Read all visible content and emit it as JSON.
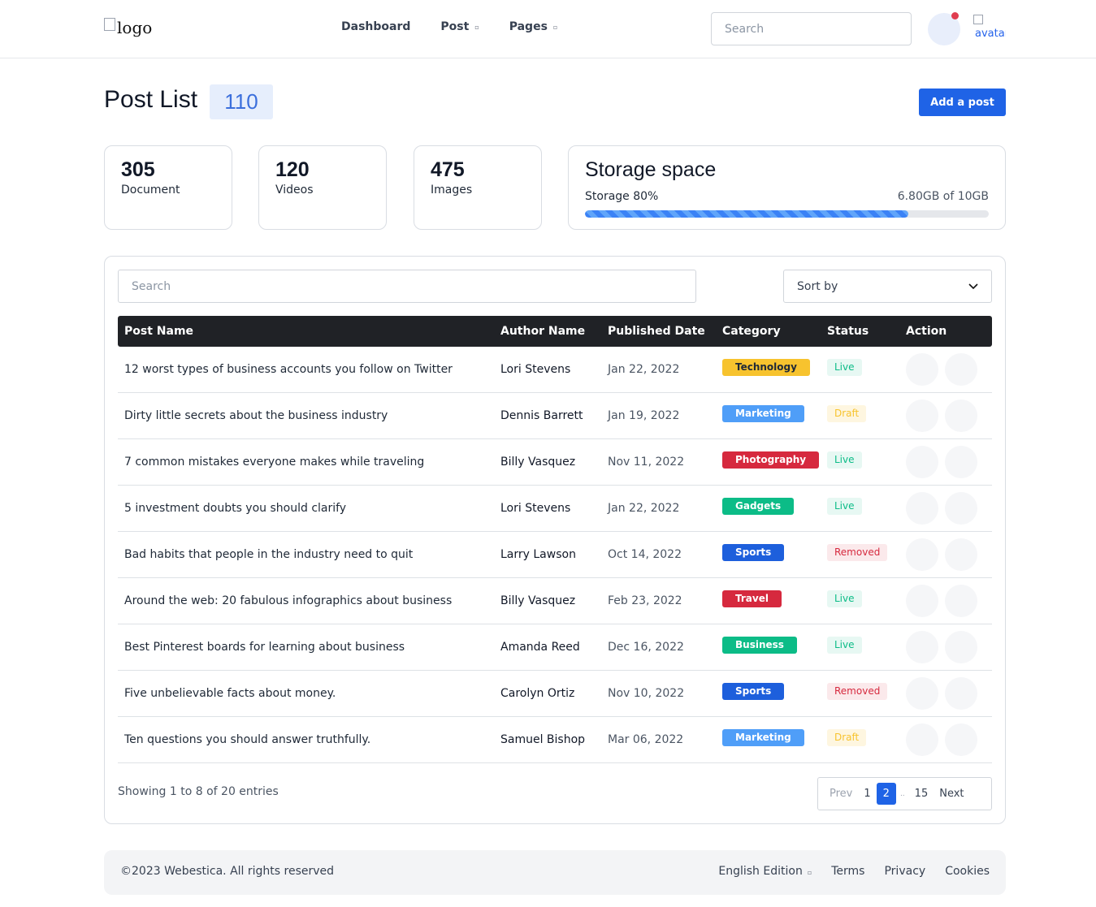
{
  "header": {
    "logo_alt": "logo",
    "nav": [
      {
        "label": "Dashboard",
        "has_dropdown": false
      },
      {
        "label": "Post",
        "has_dropdown": true
      },
      {
        "label": "Pages",
        "has_dropdown": true
      }
    ],
    "search_placeholder": "Search",
    "avatar_alt": "avatar"
  },
  "page": {
    "title": "Post List",
    "count": "110",
    "add_button": "Add a post"
  },
  "stats": [
    {
      "value": "305",
      "label": "Document"
    },
    {
      "value": "120",
      "label": "Videos"
    },
    {
      "value": "475",
      "label": "Images"
    }
  ],
  "storage": {
    "title": "Storage space",
    "label": "Storage 80%",
    "usage": "6.80GB of 10GB",
    "percent": 80
  },
  "table": {
    "search_placeholder": "Search",
    "sort_label": "Sort by",
    "columns": [
      "Post Name",
      "Author Name",
      "Published Date",
      "Category",
      "Status",
      "Action"
    ],
    "rows": [
      {
        "name": "12 worst types of business accounts you follow on Twitter",
        "author": "Lori Stevens",
        "date": "Jan 22, 2022",
        "category": "Technology",
        "status": "Live"
      },
      {
        "name": "Dirty little secrets about the business industry",
        "author": "Dennis Barrett",
        "date": "Jan 19, 2022",
        "category": "Marketing",
        "status": "Draft"
      },
      {
        "name": "7 common mistakes everyone makes while traveling",
        "author": "Billy Vasquez",
        "date": "Nov 11, 2022",
        "category": "Photography",
        "status": "Live"
      },
      {
        "name": "5 investment doubts you should clarify",
        "author": "Lori Stevens",
        "date": "Jan 22, 2022",
        "category": "Gadgets",
        "status": "Live"
      },
      {
        "name": "Bad habits that people in the industry need to quit",
        "author": "Larry Lawson",
        "date": "Oct 14, 2022",
        "category": "Sports",
        "status": "Removed"
      },
      {
        "name": "Around the web: 20 fabulous infographics about business",
        "author": "Billy Vasquez",
        "date": "Feb 23, 2022",
        "category": "Travel",
        "status": "Live"
      },
      {
        "name": "Best Pinterest boards for learning about business",
        "author": "Amanda Reed",
        "date": "Dec 16, 2022",
        "category": "Business",
        "status": "Live"
      },
      {
        "name": "Five unbelievable facts about money.",
        "author": "Carolyn Ortiz",
        "date": "Nov 10, 2022",
        "category": "Sports",
        "status": "Removed"
      },
      {
        "name": "Ten questions you should answer truthfully.",
        "author": "Samuel Bishop",
        "date": "Mar 06, 2022",
        "category": "Marketing",
        "status": "Draft"
      }
    ],
    "category_colors": {
      "Technology": {
        "bg": "#f7c32e",
        "fg": "#1f2937"
      },
      "Marketing": {
        "bg": "#4f9ef8",
        "fg": "#ffffff"
      },
      "Photography": {
        "bg": "#d6293e",
        "fg": "#ffffff"
      },
      "Gadgets": {
        "bg": "#0cbc87",
        "fg": "#ffffff"
      },
      "Sports": {
        "bg": "#1d5fdc",
        "fg": "#ffffff"
      },
      "Travel": {
        "bg": "#d6293e",
        "fg": "#ffffff"
      },
      "Business": {
        "bg": "#0cbc87",
        "fg": "#ffffff"
      }
    },
    "status_colors": {
      "Live": {
        "bg": "#e7f8f3",
        "fg": "#0cbc87"
      },
      "Draft": {
        "bg": "#fef6e0",
        "fg": "#f7c32e"
      },
      "Removed": {
        "bg": "#fbe9eb",
        "fg": "#d6293e"
      }
    },
    "showing": "Showing 1 to 8 of 20 entries",
    "pagination": {
      "prev": "Prev",
      "pages": [
        "1",
        "2"
      ],
      "current": "2",
      "dots": "..",
      "last": "15",
      "next": "Next"
    }
  },
  "footer": {
    "copyright": "©2023 Webestica. All rights reserved",
    "edition": "English Edition",
    "links": [
      "Terms",
      "Privacy",
      "Cookies"
    ]
  }
}
